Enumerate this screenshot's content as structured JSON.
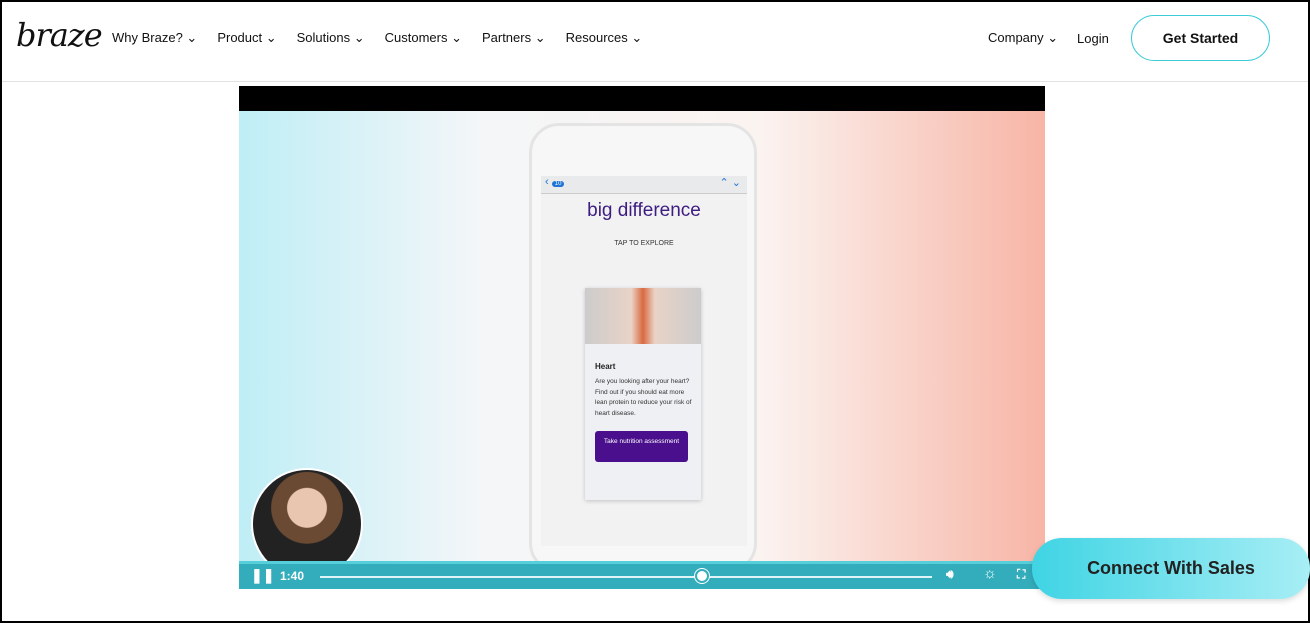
{
  "nav": {
    "logo": "braze",
    "items": [
      "Why Braze? ⌄",
      "Product ⌄",
      "Solutions ⌄",
      "Customers ⌄",
      "Partners ⌄",
      "Resources ⌄"
    ],
    "company": "Company ⌄",
    "login": "Login",
    "get_started": "Get Started"
  },
  "video": {
    "phone": {
      "badge": "10",
      "heading": "big difference",
      "tap": "TAP TO EXPLORE",
      "card": {
        "title": "Heart",
        "body": "Are you looking after your heart? Find out if you should eat more lean protein to reduce your risk of heart disease.",
        "cta": "Take nutrition assessment"
      }
    },
    "time": "1:40",
    "progress_percent": 62.6,
    "accent": "#33adbb"
  },
  "sales_button": "Connect With Sales"
}
